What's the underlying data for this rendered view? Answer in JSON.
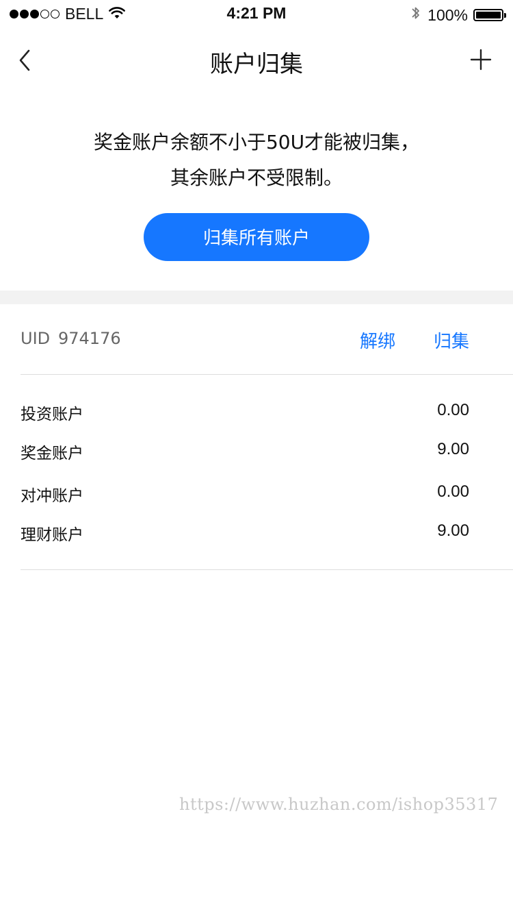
{
  "status_bar": {
    "carrier": "BELL",
    "time": "4:21 PM",
    "battery_percent": "100%",
    "signal_bars_filled": 3,
    "signal_bars_total": 5
  },
  "nav": {
    "title": "账户归集"
  },
  "notice": {
    "line1": "奖金账户余额不小于50U才能被归集，",
    "line2": "其余账户不受限制。"
  },
  "collect_all_button": "归集所有账户",
  "account": {
    "uid_label": "UID",
    "uid_value": "974176",
    "unbind_label": "解绑",
    "collect_label": "归集",
    "balances": [
      {
        "label": "投资账户",
        "value": "0.00"
      },
      {
        "label": "奖金账户",
        "value": "9.00"
      },
      {
        "label": "对冲账户",
        "value": "0.00"
      },
      {
        "label": "理财账户",
        "value": "9.00"
      }
    ]
  },
  "watermark": "https://www.huzhan.com/ishop35317",
  "colors": {
    "accent": "#1677ff",
    "section_gap": "#f2f2f2",
    "muted_text": "#666666"
  }
}
